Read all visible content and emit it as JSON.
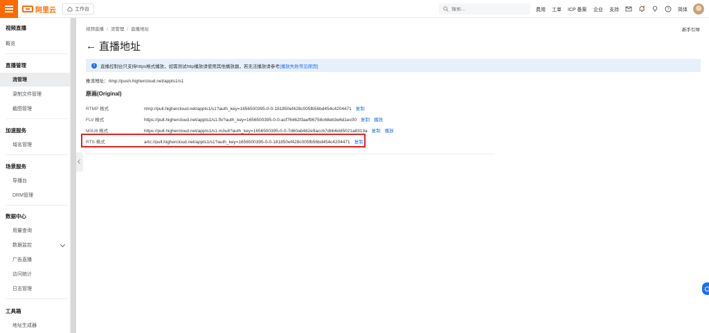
{
  "topbar": {
    "brand": "阿里云",
    "workbench": "工作台",
    "search_placeholder": "搜索...",
    "links": [
      "费用",
      "工单",
      "ICP 备案",
      "企业",
      "支持"
    ],
    "language": "简体",
    "icons": [
      "message-icon",
      "bell-icon",
      "lightbulb-icon",
      "help-icon"
    ]
  },
  "sidebar": {
    "title": "视频直播",
    "overview": "概览",
    "groups": [
      {
        "title": "直播管理",
        "items": [
          "流管理",
          "录制文件管理",
          "截图管理"
        ]
      },
      {
        "title": "加速服务",
        "items": [
          "域名管理"
        ]
      },
      {
        "title": "场景服务",
        "items": [
          "导播台",
          "DRM管理"
        ]
      },
      {
        "title": "数据中心",
        "items": [
          "用量查询",
          "数据监控",
          "广告直播",
          "访问统计",
          "日志管理"
        ]
      },
      {
        "title": "工具箱",
        "items": [
          "地址生成器"
        ]
      }
    ],
    "active_item": "流管理"
  },
  "breadcrumb": [
    "视频直播",
    "流管理",
    "直播地址"
  ],
  "help_link": "新手引导",
  "page_title": "直播地址",
  "notice": {
    "text": "直播控制台只支持https格式播放，如需测试http播放请使用其他播放器，若无法播放请参考",
    "link": "[播放失败常见原因]"
  },
  "push": {
    "label": "推流地址：",
    "value": "rtmp://push.highercloud.net/appts1/s1"
  },
  "section_title": "原画(Original)",
  "streams": [
    {
      "label": "RTMP 格式",
      "url": "rtmp://pull.highercloud.net/appts1/s1?auth_key=1656500395-0-0-181850ef428c005fb56bd454c4204471",
      "actions": [
        "复制"
      ]
    },
    {
      "label": "FLV 格式",
      "url": "https://pull.highercloud.net/appts1/s1.flv?auth_key=1656500395-0-0-acf76462f3aef96758c68eb3e6d1ec00",
      "actions": [
        "复制",
        "播放"
      ]
    },
    {
      "label": "M3U8 格式",
      "url": "https://pull.highercloud.net/appts1/s1.m3u8?auth_key=1656500395-0-0-7d60ab482e9accb7dbb6dd5021a8313a",
      "actions": [
        "复制",
        "播放"
      ]
    },
    {
      "label": "RTS 格式",
      "url": "artc://pull.highercloud.net/appts1/s1?auth_key=1656500395-0-0-181850ef428c005fb56bd454c4204471",
      "actions": [
        "复制"
      ]
    }
  ],
  "colors": {
    "brand": "#ff6a00",
    "link": "#1f6ff3",
    "highlight": "#e02020",
    "notice_bg": "#e6f0fb"
  }
}
